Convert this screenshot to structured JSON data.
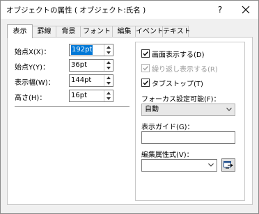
{
  "window": {
    "title": "オブジェクトの属性 ( オブジェクト:氏名 )",
    "help_label": "?"
  },
  "tabs": [
    {
      "label": "表示",
      "active": true
    },
    {
      "label": "罫線"
    },
    {
      "label": "背景"
    },
    {
      "label": "フォント"
    },
    {
      "label": "編集"
    },
    {
      "label": "イベント"
    },
    {
      "label": "テキスト"
    }
  ],
  "position": {
    "x_label": "始点X(X)：",
    "x_value": "192pt",
    "y_label": "始点Y(Y)：",
    "y_value": "36pt",
    "width_label": "表示幅(W)：",
    "width_value": "144pt",
    "height_label": "高さ(H)：",
    "height_value": "16pt"
  },
  "options": {
    "show_on_screen_label": "画面表示する(D)",
    "show_on_screen_checked": true,
    "repeat_display_label": "繰り返し表示する(R)",
    "repeat_display_checked": true,
    "repeat_display_enabled": false,
    "tab_stop_label": "タブストップ(T)",
    "tab_stop_checked": true,
    "focus_label": "フォーカス設定可能(F)：",
    "focus_value": "自動",
    "guide_label": "表示ガイド(G)：",
    "guide_value": "",
    "edit_format_label": "編集属性式(V)：",
    "edit_format_value": ""
  },
  "icons": {
    "close": "close-icon",
    "spin_up": "spin-up-icon",
    "spin_down": "spin-down-icon",
    "check": "checkmark-icon",
    "dropdown": "chevron-down-icon",
    "builder": "expression-builder-icon"
  },
  "colors": {
    "selection": "#0078d7",
    "disabled_text": "#9a9a9a",
    "panel_bg": "#ffffff",
    "dialog_bg": "#f0f0f0"
  }
}
